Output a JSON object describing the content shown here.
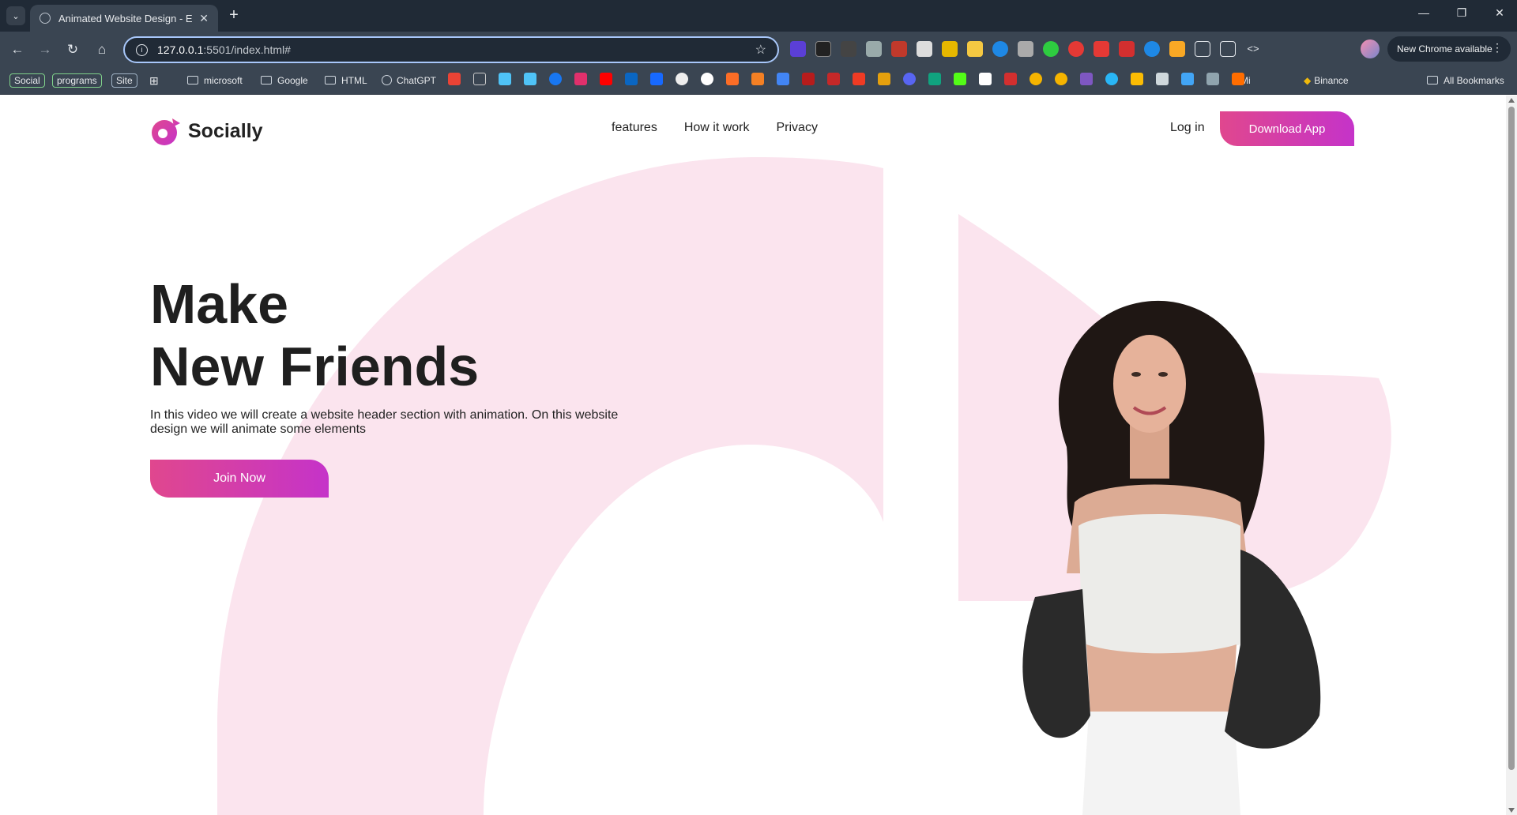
{
  "browser": {
    "tab_title": "Animated Website Design - Eas",
    "url_host": "127.0.0.1",
    "url_rest": ":5501/index.html#",
    "update_label": "New Chrome available"
  },
  "bookmarks": {
    "chips": [
      "Social",
      "programs",
      "Site"
    ],
    "items": [
      {
        "label": "microsoft",
        "kind": "folder"
      },
      {
        "label": "Google",
        "kind": "folder"
      },
      {
        "label": "HTML",
        "kind": "folder"
      },
      {
        "label": "ChatGPT",
        "kind": "link"
      },
      {
        "label": "Mi",
        "kind": "link"
      },
      {
        "label": "Binance",
        "kind": "link"
      }
    ],
    "all_label": "All Bookmarks"
  },
  "site": {
    "brand": "Socially",
    "accent_start": "#e0478e",
    "accent_end": "#c533c9",
    "bg_shape_color": "#fbe4ee",
    "nav": [
      "features",
      "How it work",
      "Privacy"
    ],
    "login_label": "Log in",
    "download_label": "Download App",
    "hero_line1": "Make",
    "hero_line2": "New Friends",
    "hero_desc": "In this video we will create a website header section with animation. On this website design we will animate some elements",
    "join_label": "Join Now"
  }
}
